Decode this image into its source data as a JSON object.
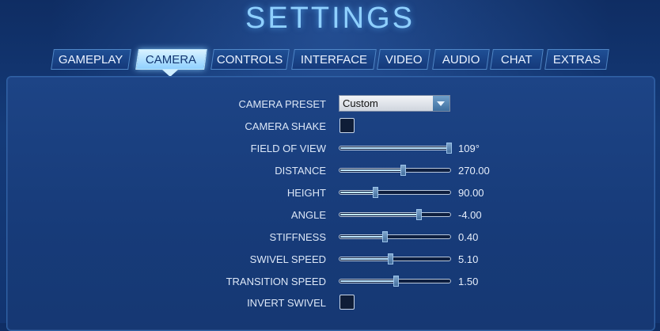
{
  "header": {
    "title": "SETTINGS"
  },
  "tabs": [
    {
      "label": "GAMEPLAY",
      "active": false
    },
    {
      "label": "CAMERA",
      "active": true
    },
    {
      "label": "CONTROLS",
      "active": false
    },
    {
      "label": "INTERFACE",
      "active": false
    },
    {
      "label": "VIDEO",
      "active": false
    },
    {
      "label": "AUDIO",
      "active": false
    },
    {
      "label": "CHAT",
      "active": false
    },
    {
      "label": "EXTRAS",
      "active": false
    }
  ],
  "camera": {
    "preset": {
      "label": "CAMERA PRESET",
      "value": "Custom"
    },
    "shake": {
      "label": "CAMERA SHAKE",
      "checked": false
    },
    "sliders": [
      {
        "key": "field-of-view",
        "label": "FIELD OF VIEW",
        "value": "109°",
        "level": 1.0
      },
      {
        "key": "distance",
        "label": "DISTANCE",
        "value": "270.00",
        "level": 0.57
      },
      {
        "key": "height",
        "label": "HEIGHT",
        "value": "90.00",
        "level": 0.31
      },
      {
        "key": "angle",
        "label": "ANGLE",
        "value": "-4.00",
        "level": 0.72
      },
      {
        "key": "stiffness",
        "label": "STIFFNESS",
        "value": "0.40",
        "level": 0.4
      },
      {
        "key": "swivel-speed",
        "label": "SWIVEL SPEED",
        "value": "5.10",
        "level": 0.45
      },
      {
        "key": "transition-speed",
        "label": "TRANSITION SPEED",
        "value": "1.50",
        "level": 0.5
      }
    ],
    "invert_swivel": {
      "label": "INVERT SWIVEL",
      "checked": false
    }
  },
  "colors": {
    "background": "#143a78",
    "accent": "#8fd0ff",
    "active_tab": "#cfeeff"
  }
}
